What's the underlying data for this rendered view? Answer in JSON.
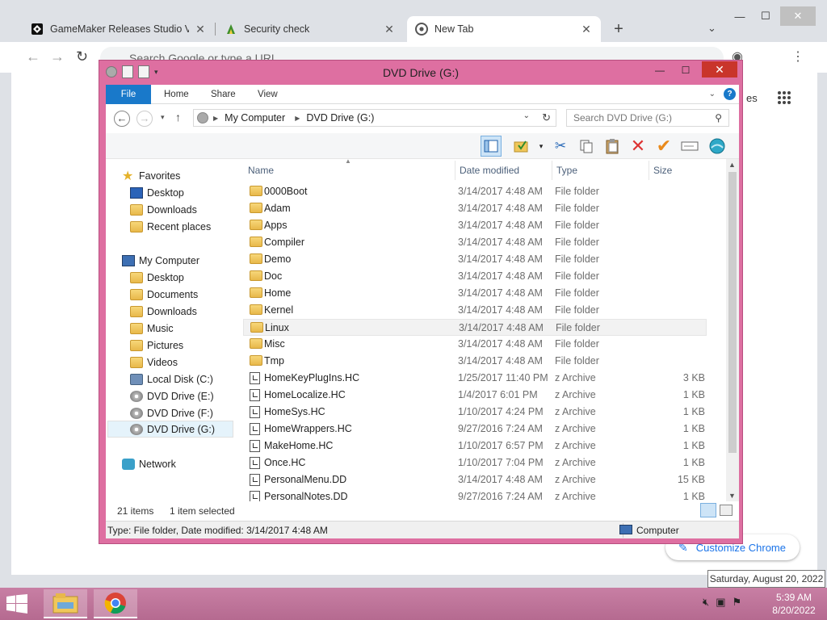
{
  "browser": {
    "tabs": [
      {
        "title": "GameMaker Releases Studio Vers",
        "close": "✕"
      },
      {
        "title": "Security check",
        "close": "✕"
      },
      {
        "title": "New Tab",
        "close": "✕"
      }
    ],
    "new_tab": "+",
    "tab_search": "⌄",
    "window_controls": {
      "minimize": "—",
      "maximize": "☐",
      "close": "✕"
    },
    "omnibox_placeholder": "Search Google or type a URL",
    "apps_label_fragment": "es",
    "customize_label": "Customize Chrome"
  },
  "explorer": {
    "title": "DVD Drive (G:)",
    "window_controls": {
      "minimize": "—",
      "maximize": "☐",
      "close": "✕"
    },
    "ribbon_tabs": [
      "File",
      "Home",
      "Share",
      "View"
    ],
    "breadcrumb": [
      "My Computer",
      "DVD Drive (G:)"
    ],
    "search_placeholder": "Search DVD Drive (G:)",
    "nav": {
      "favorites": {
        "label": "Favorites",
        "items": [
          "Desktop",
          "Downloads",
          "Recent places"
        ]
      },
      "computer": {
        "label": "My Computer",
        "items": [
          "Desktop",
          "Documents",
          "Downloads",
          "Music",
          "Pictures",
          "Videos",
          "Local Disk (C:)",
          "DVD Drive (E:)",
          "DVD Drive (F:)",
          "DVD Drive (G:)"
        ]
      },
      "network": "Network"
    },
    "columns": [
      "Name",
      "Date modified",
      "Type",
      "Size"
    ],
    "files": [
      {
        "name": "0000Boot",
        "date": "3/14/2017 4:48 AM",
        "type": "File folder",
        "size": "",
        "kind": "folder"
      },
      {
        "name": "Adam",
        "date": "3/14/2017 4:48 AM",
        "type": "File folder",
        "size": "",
        "kind": "folder"
      },
      {
        "name": "Apps",
        "date": "3/14/2017 4:48 AM",
        "type": "File folder",
        "size": "",
        "kind": "folder"
      },
      {
        "name": "Compiler",
        "date": "3/14/2017 4:48 AM",
        "type": "File folder",
        "size": "",
        "kind": "folder"
      },
      {
        "name": "Demo",
        "date": "3/14/2017 4:48 AM",
        "type": "File folder",
        "size": "",
        "kind": "folder"
      },
      {
        "name": "Doc",
        "date": "3/14/2017 4:48 AM",
        "type": "File folder",
        "size": "",
        "kind": "folder"
      },
      {
        "name": "Home",
        "date": "3/14/2017 4:48 AM",
        "type": "File folder",
        "size": "",
        "kind": "folder"
      },
      {
        "name": "Kernel",
        "date": "3/14/2017 4:48 AM",
        "type": "File folder",
        "size": "",
        "kind": "folder"
      },
      {
        "name": "Linux",
        "date": "3/14/2017 4:48 AM",
        "type": "File folder",
        "size": "",
        "kind": "folder"
      },
      {
        "name": "Misc",
        "date": "3/14/2017 4:48 AM",
        "type": "File folder",
        "size": "",
        "kind": "folder"
      },
      {
        "name": "Tmp",
        "date": "3/14/2017 4:48 AM",
        "type": "File folder",
        "size": "",
        "kind": "folder"
      },
      {
        "name": "HomeKeyPlugIns.HC",
        "date": "1/25/2017 11:40 PM",
        "type": "z Archive",
        "size": "3 KB",
        "kind": "file"
      },
      {
        "name": "HomeLocalize.HC",
        "date": "1/4/2017 6:01 PM",
        "type": "z Archive",
        "size": "1 KB",
        "kind": "file"
      },
      {
        "name": "HomeSys.HC",
        "date": "1/10/2017 4:24 PM",
        "type": "z Archive",
        "size": "1 KB",
        "kind": "file"
      },
      {
        "name": "HomeWrappers.HC",
        "date": "9/27/2016 7:24 AM",
        "type": "z Archive",
        "size": "1 KB",
        "kind": "file"
      },
      {
        "name": "MakeHome.HC",
        "date": "1/10/2017 6:57 PM",
        "type": "z Archive",
        "size": "1 KB",
        "kind": "file"
      },
      {
        "name": "Once.HC",
        "date": "1/10/2017 7:04 PM",
        "type": "z Archive",
        "size": "1 KB",
        "kind": "file"
      },
      {
        "name": "PersonalMenu.DD",
        "date": "3/14/2017 4:48 AM",
        "type": "z Archive",
        "size": "15 KB",
        "kind": "file"
      },
      {
        "name": "PersonalNotes.DD",
        "date": "9/27/2016 7:24 AM",
        "type": "z Archive",
        "size": "1 KB",
        "kind": "file"
      }
    ],
    "highlighted_row": "Linux",
    "item_count": "21 items",
    "selection": "1 item selected",
    "status_text": "Type: File folder, Date modified: 3/14/2017 4:48 AM",
    "status_location": "Computer"
  },
  "taskbar": {
    "time": "5:39 AM",
    "date": "8/20/2022",
    "tooltip": "Saturday, August 20, 2022"
  },
  "colors": {
    "explorer_frame": "#de6fa1",
    "ribbon_file": "#1979ca",
    "taskbar": "#b56a90",
    "chrome_frame": "#dee1e6"
  }
}
